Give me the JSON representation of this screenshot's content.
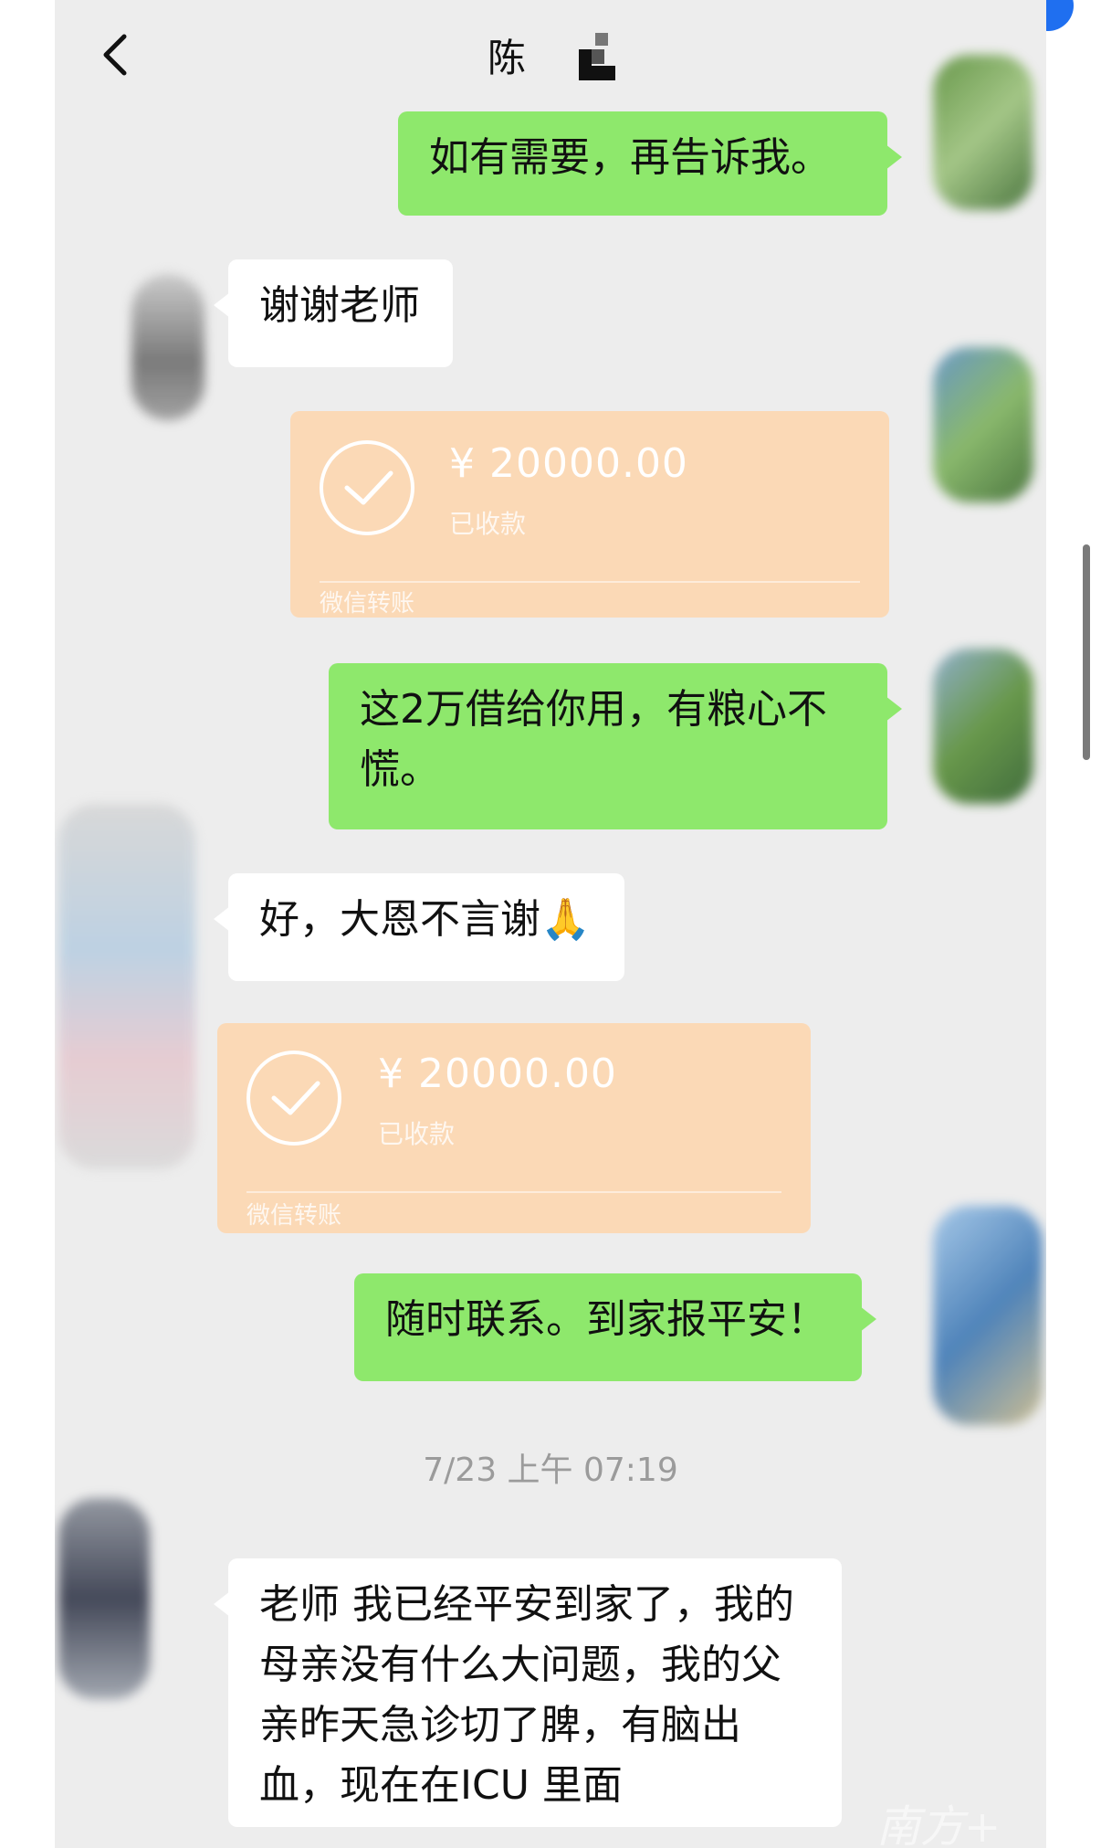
{
  "header": {
    "back_icon": "chevron-left-icon",
    "title": "陈"
  },
  "messages": [
    {
      "from": "me",
      "text": "如有需要，再告诉我。"
    },
    {
      "from": "them",
      "text": "谢谢老师"
    },
    {
      "from": "me",
      "type": "transfer",
      "amount": "¥ 20000.00",
      "status": "已收款",
      "footer": "微信转账"
    },
    {
      "from": "me",
      "text": "这2万借给你用，有粮心不慌。"
    },
    {
      "from": "them",
      "text": "好，大恩不言谢🙏"
    },
    {
      "from": "them",
      "type": "transfer",
      "amount": "¥ 20000.00",
      "status": "已收款",
      "footer": "微信转账"
    },
    {
      "from": "me",
      "text": "随时联系。到家报平安！"
    },
    {
      "from": "them",
      "text": "老师 我已经平安到家了，我的母亲没有什么大问题，我的父亲昨天急诊切了脾，有脑出血，现在在ICU 里面"
    }
  ],
  "timestamp": "7/23 上午 07:19",
  "watermark": "南方+",
  "colors": {
    "background": "#ededed",
    "my_bubble": "#8ee86c",
    "their_bubble": "#ffffff",
    "transfer_card": "#fbd9b6",
    "notification_dot": "#1f6ff0"
  }
}
